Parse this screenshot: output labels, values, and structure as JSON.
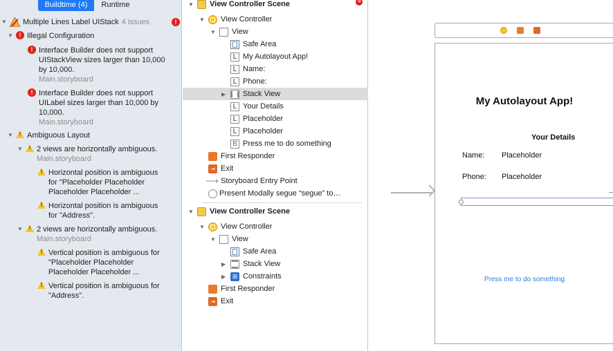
{
  "issues": {
    "tabs": [
      {
        "label": "Buildtime (4)",
        "active": true
      },
      {
        "label": "Runtime",
        "active": false
      }
    ],
    "project": {
      "name": "Multiple Lines Label UIStack",
      "count": "4 issues"
    },
    "groups": [
      {
        "title": "Illegal Configuration",
        "kind": "error",
        "items": [
          {
            "lines": [
              "Interface Builder does not support",
              "UIStackView sizes larger than 10,000",
              "by 10,000."
            ],
            "file": "Main.storyboard"
          },
          {
            "lines": [
              "Interface Builder does not support",
              "UILabel sizes larger than 10,000 by",
              "10,000."
            ],
            "file": "Main.storyboard"
          }
        ]
      },
      {
        "title": "Ambiguous Layout",
        "kind": "warning",
        "subgroups": [
          {
            "title": "2 views are horizontally ambiguous.",
            "file": "Main.storyboard",
            "items": [
              {
                "lines": [
                  "Horizontal position is ambiguous",
                  "for \"Placeholder Placeholder",
                  "Placeholder Placeholder ..."
                ]
              },
              {
                "lines": [
                  "Horizontal position is ambiguous",
                  "for \"Address\"."
                ]
              }
            ]
          },
          {
            "title": "2 views are horizontally ambiguous.",
            "file": "Main.storyboard",
            "items": [
              {
                "lines": [
                  "Vertical position is ambiguous for",
                  "\"Placeholder Placeholder",
                  "Placeholder Placeholder ..."
                ]
              },
              {
                "lines": [
                  "Vertical position is ambiguous for",
                  "\"Address\"."
                ]
              }
            ]
          }
        ]
      }
    ]
  },
  "outline": {
    "scene1": {
      "title": "View Controller Scene",
      "view_controller": "View Controller",
      "view": "View",
      "children": [
        {
          "icon": "safe-area-icon",
          "label": "Safe Area"
        },
        {
          "icon": "label-icon",
          "label": "My Autolayout App!"
        },
        {
          "icon": "label-icon",
          "label": "Name:"
        },
        {
          "icon": "label-icon",
          "label": "Phone:"
        },
        {
          "icon": "stack-view-icon",
          "label": "Stack View"
        },
        {
          "icon": "label-icon",
          "label": "Your Details"
        },
        {
          "icon": "label-icon",
          "label": "Placeholder"
        },
        {
          "icon": "label-icon",
          "label": "Placeholder"
        },
        {
          "icon": "button-icon",
          "label": "Press me to do something"
        }
      ],
      "first_responder": "First Responder",
      "exit": "Exit",
      "entry_point": "Storyboard Entry Point",
      "segue": "Present Modally segue “segue” to…"
    },
    "scene2": {
      "title": "View Controller Scene",
      "view_controller": "View Controller",
      "view": "View",
      "children": [
        {
          "icon": "safe-area-icon",
          "label": "Safe Area"
        },
        {
          "icon": "stack-view-icon",
          "label": "Stack View"
        },
        {
          "icon": "constraints-icon",
          "label": "Constraints"
        }
      ],
      "first_responder": "First Responder",
      "exit": "Exit"
    }
  },
  "canvas": {
    "app_title": "My Autolayout App!",
    "your_details": "Your Details",
    "name_label": "Name:",
    "name_value": "Placeholder",
    "phone_label": "Phone:",
    "phone_value": "Placeholder",
    "button": "Press me to do something"
  },
  "colors": {
    "accent": "#1d7af8",
    "error": "#e0201c",
    "warning": "#f6c431",
    "link": "#2f7adf"
  }
}
